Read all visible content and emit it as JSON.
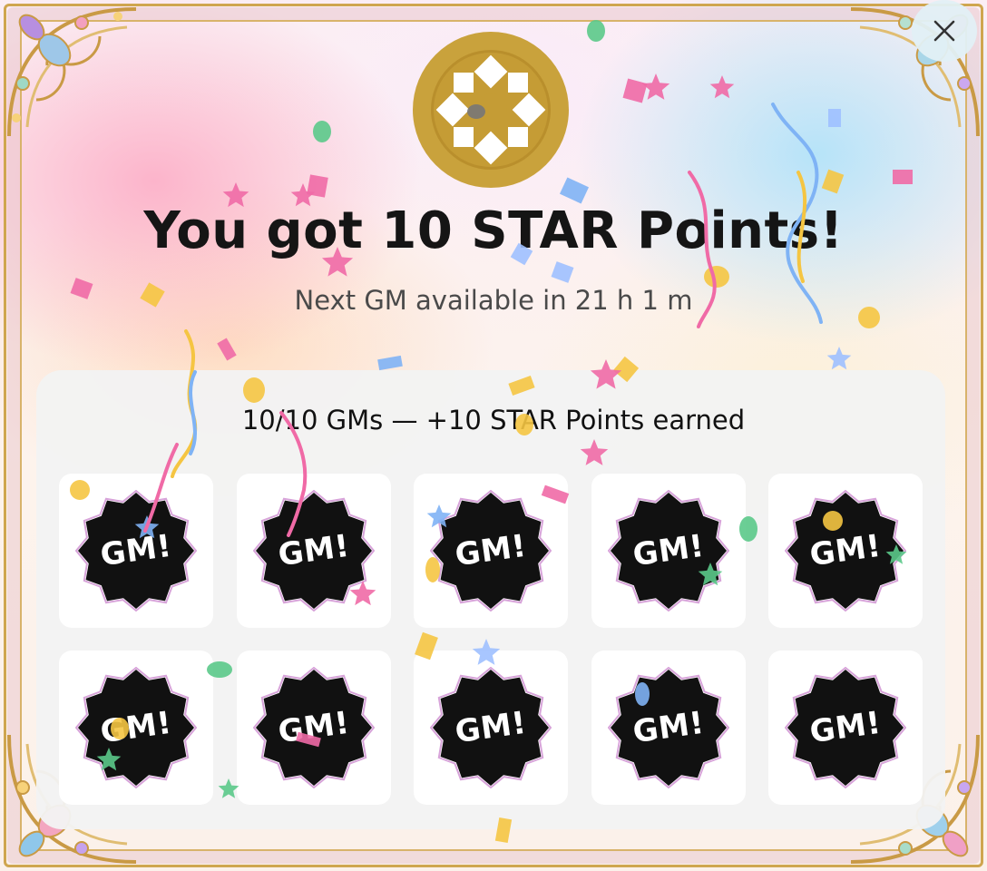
{
  "dialog": {
    "close_label": "×",
    "close_icon": "close-icon",
    "coin_icon": "star-coin-icon",
    "title": "You got 10 STAR Points!",
    "subtitle": "Next GM available in 21 h 1 m",
    "progress_text": "10/10 GMs — +10 STAR Points earned",
    "badges": [
      {
        "label": "GM!"
      },
      {
        "label": "GM!"
      },
      {
        "label": "GM!"
      },
      {
        "label": "GM!"
      },
      {
        "label": "GM!"
      },
      {
        "label": "GM!"
      },
      {
        "label": "GM!"
      },
      {
        "label": "GM!"
      },
      {
        "label": "GM!"
      },
      {
        "label": "GM!"
      }
    ]
  },
  "colors": {
    "gold": "#c9a23c",
    "badge_fill": "#111111",
    "title_text": "#151515",
    "confetti": [
      "#f06aa6",
      "#f5c542",
      "#7fb3f5",
      "#e85d9a",
      "#5bc98a",
      "#9ec0ff"
    ]
  }
}
